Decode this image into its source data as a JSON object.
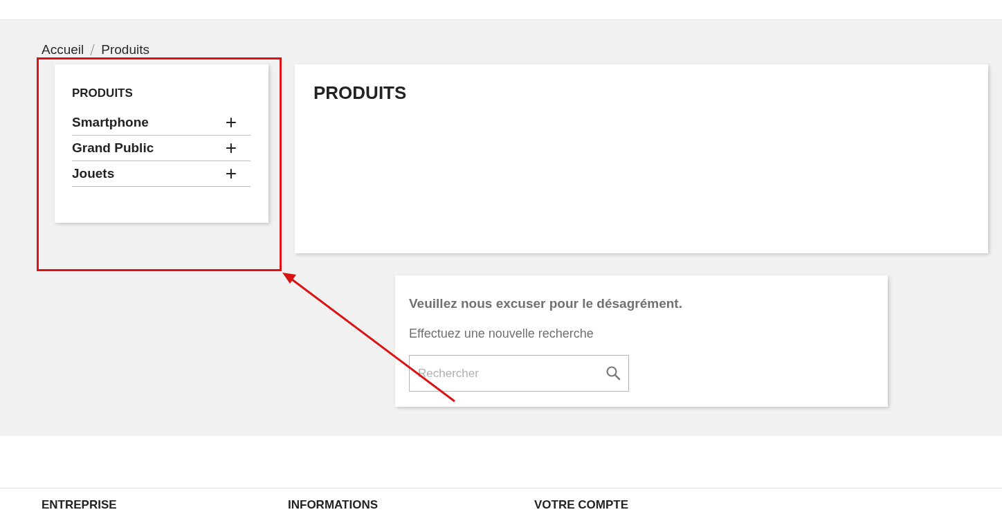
{
  "breadcrumb": [
    "Accueil",
    "Produits"
  ],
  "sidebar": {
    "title": "PRODUITS",
    "items": [
      {
        "label": "Smartphone",
        "expand_icon": "+"
      },
      {
        "label": "Grand Public",
        "expand_icon": "+"
      },
      {
        "label": "Jouets",
        "expand_icon": "+"
      }
    ]
  },
  "main": {
    "title": "PRODUITS"
  },
  "notice": {
    "title": "Veuillez nous excuser pour le désagrément.",
    "text": "Effectuez une nouvelle recherche",
    "search": {
      "placeholder": "Rechercher"
    }
  },
  "footer": {
    "headings": [
      "ENTREPRISE",
      "INFORMATIONS",
      "VOTRE COMPTE"
    ]
  },
  "annotation": {
    "kind": "highlight-arrow"
  }
}
